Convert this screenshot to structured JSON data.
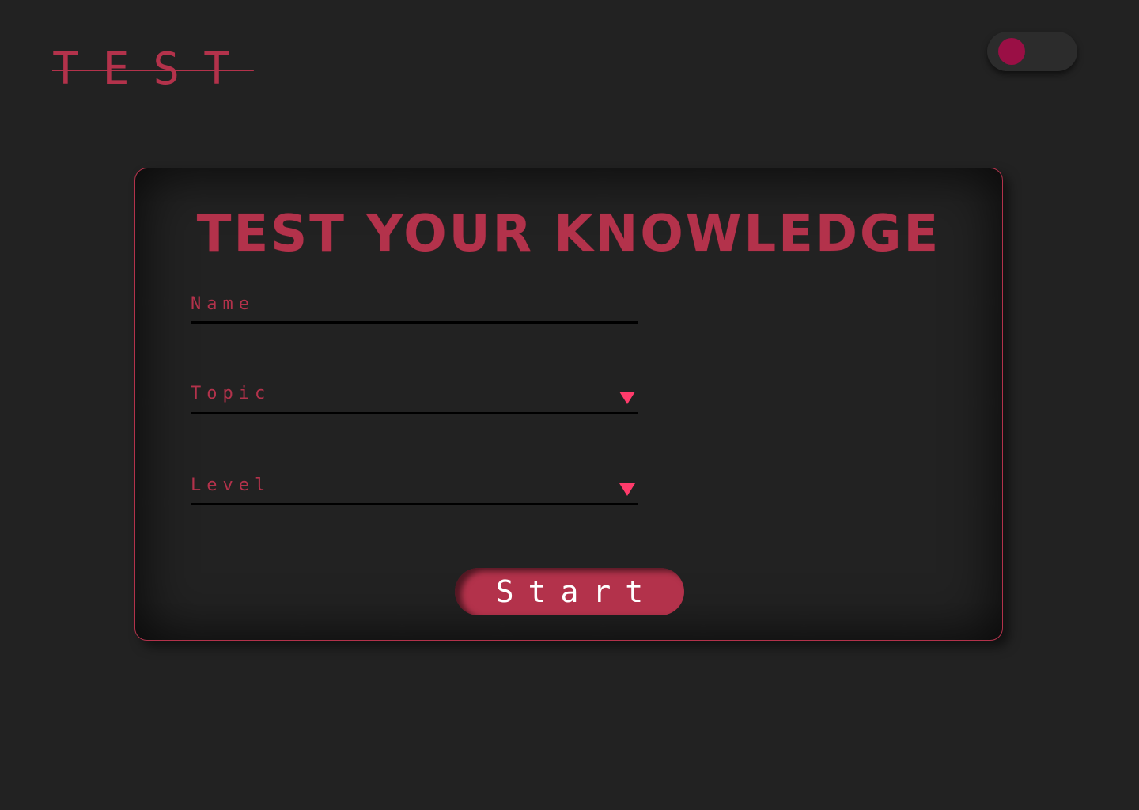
{
  "header": {
    "logo_text": "TEST"
  },
  "theme_toggle": {
    "knob_color": "#9a0f45",
    "state": "on"
  },
  "card": {
    "title": "TEST YOUR KNOWLEDGE",
    "name_field": {
      "placeholder": "Name",
      "value": ""
    },
    "topic_select": {
      "selected": "Topic"
    },
    "level_select": {
      "selected": "Level"
    },
    "start_label": "Start"
  },
  "colors": {
    "background": "#222222",
    "accent": "#b3324b",
    "caret": "#ff3b6b",
    "underline": "#000000"
  }
}
